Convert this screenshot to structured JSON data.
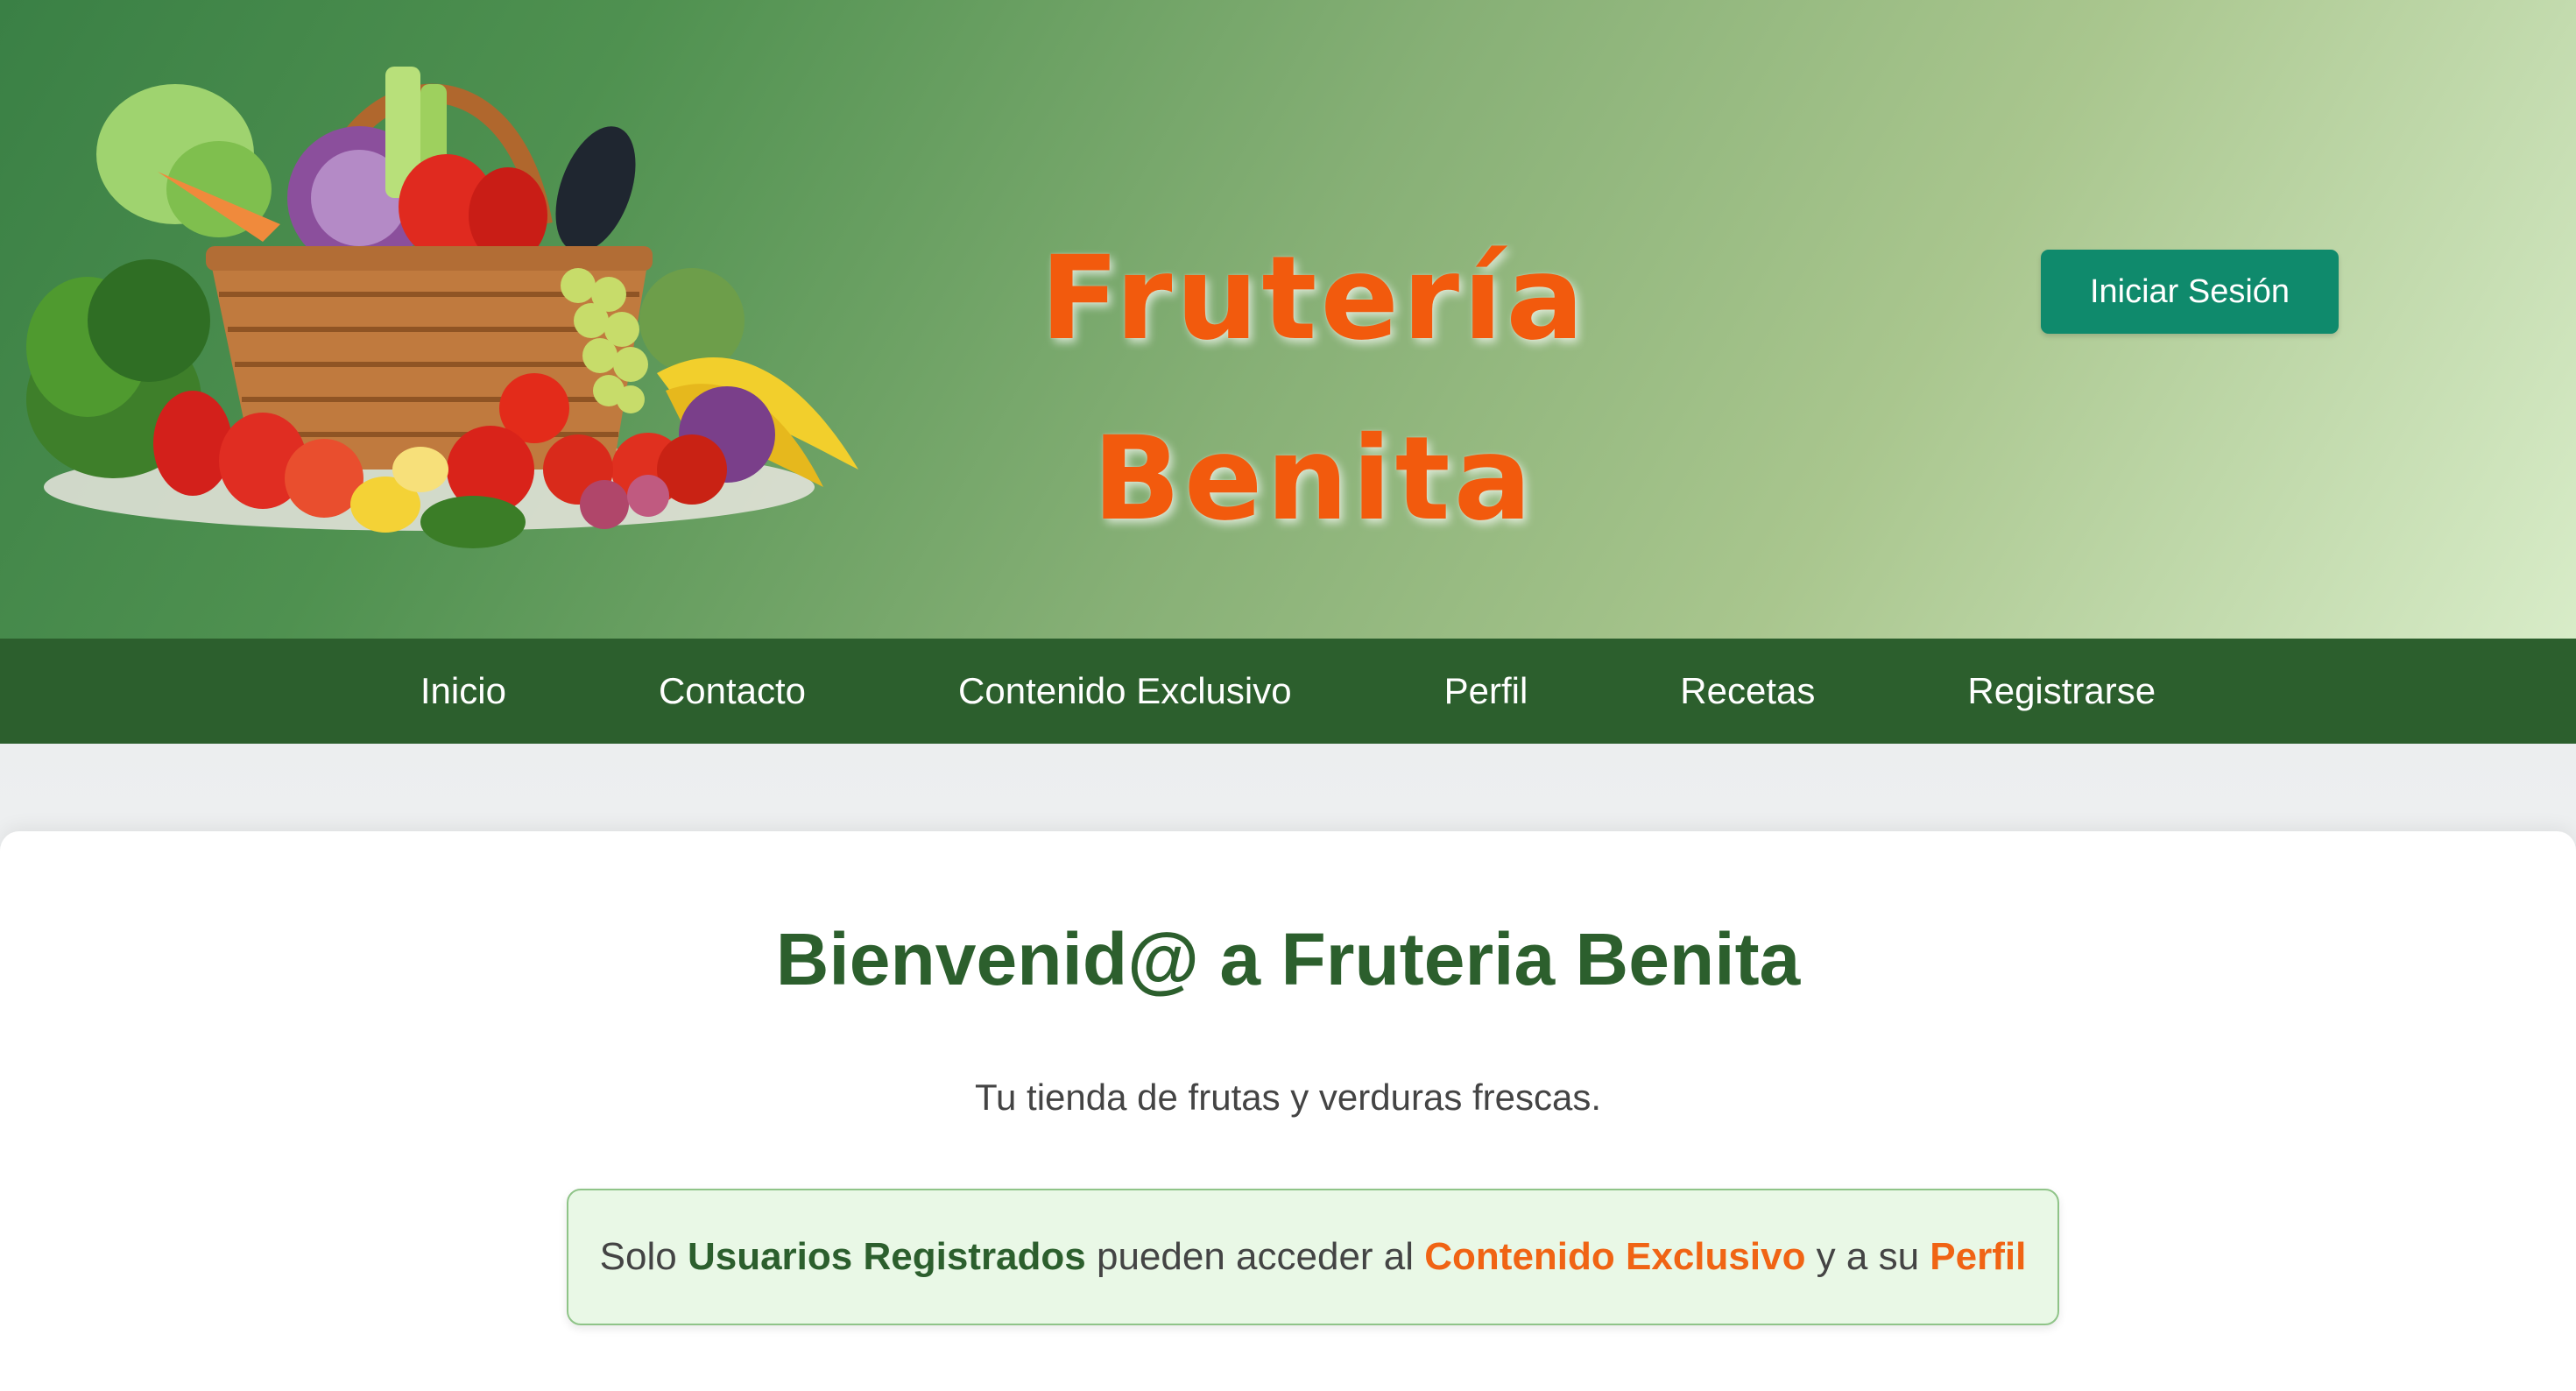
{
  "header": {
    "brand_title": "Frutería\nBenita",
    "login_label": "Iniciar Sesión",
    "hero_image_icon": "fruit-vegetable-basket-image"
  },
  "nav": {
    "items": [
      {
        "label": "Inicio"
      },
      {
        "label": "Contacto"
      },
      {
        "label": "Contenido Exclusivo"
      },
      {
        "label": "Perfil"
      },
      {
        "label": "Recetas"
      },
      {
        "label": "Registrarse"
      }
    ]
  },
  "main": {
    "heading": "Bienvenid@ a Fruteria Benita",
    "tagline": "Tu tienda de frutas y verduras frescas.",
    "notice": {
      "part1": "Solo ",
      "registered_users": "Usuarios Registrados",
      "part2": " pueden acceder al ",
      "exclusive_content": "Contenido Exclusivo",
      "part3": " y a su ",
      "profile": "Perfil"
    }
  },
  "colors": {
    "nav_bg": "#2c5f2d",
    "brand_orange": "#f25a0d",
    "login_button": "#0f8a6c",
    "heading_green": "#2c5f2d",
    "notice_bg": "#e9f8e6",
    "notice_accent": "#f06414"
  }
}
